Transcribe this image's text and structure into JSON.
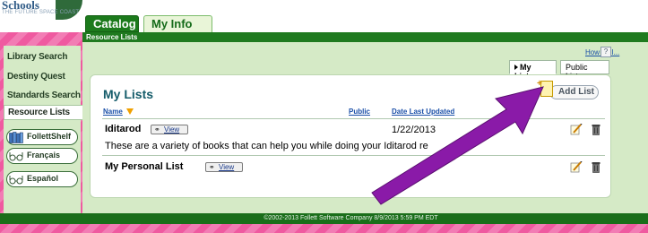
{
  "logo": {
    "main": "Schools",
    "sub": "THE FUTURE SPACE COAST"
  },
  "tabs": {
    "catalog": "Catalog",
    "myinfo": "My Info"
  },
  "breadcrumb": "Resource Lists",
  "sidebar": {
    "items": [
      "Library Search",
      "Destiny Quest",
      "Standards Search"
    ],
    "active": "Resource Lists",
    "buttons": [
      {
        "label": "FollettShelf",
        "icon": "follettshelf-icon"
      },
      {
        "label": "Français",
        "icon": "glasses-icon"
      },
      {
        "label": "Español",
        "icon": "glasses-icon"
      }
    ]
  },
  "help": {
    "howdo": "How do I...",
    "q": "?"
  },
  "list_tabs": {
    "my": "My Lists",
    "public": "Public Lists"
  },
  "main": {
    "heading": "My Lists",
    "add_list": "Add List",
    "columns": {
      "name": "Name",
      "public": "Public",
      "date": "Date Last Updated"
    },
    "rows": [
      {
        "name": "Iditarod",
        "view": "View",
        "date": "1/22/2013",
        "desc": "These are a variety of books that can help you while doing your Iditarod re"
      },
      {
        "name": "My Personal List",
        "view": "View",
        "date": "",
        "desc": ""
      }
    ]
  },
  "footer": "©2002-2013  Follett Software Company    8/9/2013 5:59 PM EDT",
  "colors": {
    "brand_green": "#1f7a1f",
    "sidebar_bg": "#d5eac6",
    "annotation_arrow": "#8a1aa8",
    "background_stripes": "#ef5aa0"
  }
}
